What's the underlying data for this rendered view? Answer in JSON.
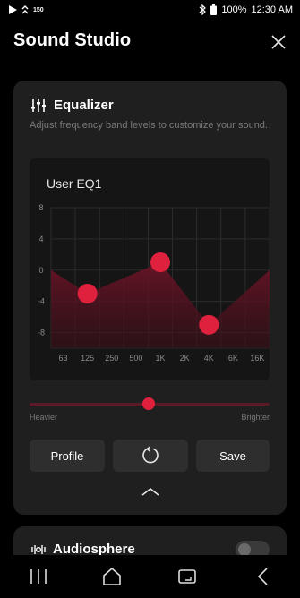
{
  "status_bar": {
    "net_speed": "150",
    "battery": "100%",
    "time": "12:30 AM"
  },
  "header": {
    "title": "Sound Studio"
  },
  "equalizer": {
    "title": "Equalizer",
    "description": "Adjust frequency band levels to customize your sound.",
    "preset_name": "User EQ1",
    "accent_color": "#e0213d",
    "chart_data": {
      "type": "area",
      "categories": [
        "63",
        "125",
        "250",
        "500",
        "1K",
        "2K",
        "4K",
        "6K",
        "16K"
      ],
      "y_ticks": [
        "8",
        "4",
        "0",
        "-4",
        "-8"
      ],
      "ylim": [
        -10,
        8
      ],
      "curve": [
        {
          "x": "63",
          "y": 0
        },
        {
          "x": "125",
          "y": -3
        },
        {
          "x": "1K",
          "y": 1
        },
        {
          "x": "4K",
          "y": -7
        },
        {
          "x": "16K",
          "y": 0
        }
      ],
      "handles": [
        {
          "x": "125",
          "y": -3
        },
        {
          "x": "1K",
          "y": 1
        },
        {
          "x": "4K",
          "y": -7
        }
      ],
      "grid": true
    }
  },
  "tone_slider": {
    "min_label": "Heavier",
    "max_label": "Brighter",
    "value": 0.5
  },
  "buttons": {
    "profile": "Profile",
    "save": "Save"
  },
  "audiosphere": {
    "title": "Audiosphere",
    "enabled": false
  }
}
